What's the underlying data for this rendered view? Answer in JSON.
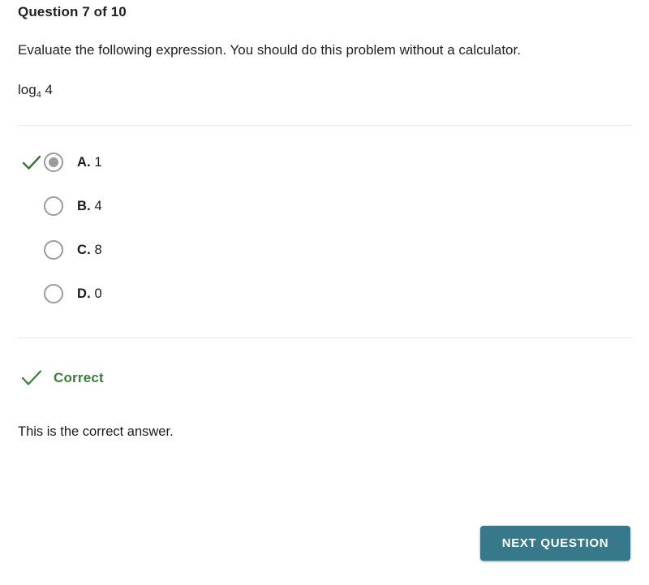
{
  "question": {
    "counter": "Question 7 of 10",
    "prompt": "Evaluate the following expression. You should do this problem without a calculator.",
    "expression_base": "log",
    "expression_subscript": "4",
    "expression_argument": " 4"
  },
  "options": [
    {
      "letter": "A.",
      "value": "1",
      "selected": true,
      "marked_correct": true
    },
    {
      "letter": "B.",
      "value": "4",
      "selected": false,
      "marked_correct": false
    },
    {
      "letter": "C.",
      "value": "8",
      "selected": false,
      "marked_correct": false
    },
    {
      "letter": "D.",
      "value": "0",
      "selected": false,
      "marked_correct": false
    }
  ],
  "feedback": {
    "status": "Correct",
    "explanation": "This is the correct answer."
  },
  "footer": {
    "next_label": "NEXT QUESTION"
  },
  "colors": {
    "correct_green": "#3e7b3e",
    "check_green": "#3e703e",
    "button_teal": "#37788a",
    "radio_gray": "#9b9b9b",
    "divider_gray": "#e6e6e6",
    "text_primary": "#1b1b1b"
  }
}
